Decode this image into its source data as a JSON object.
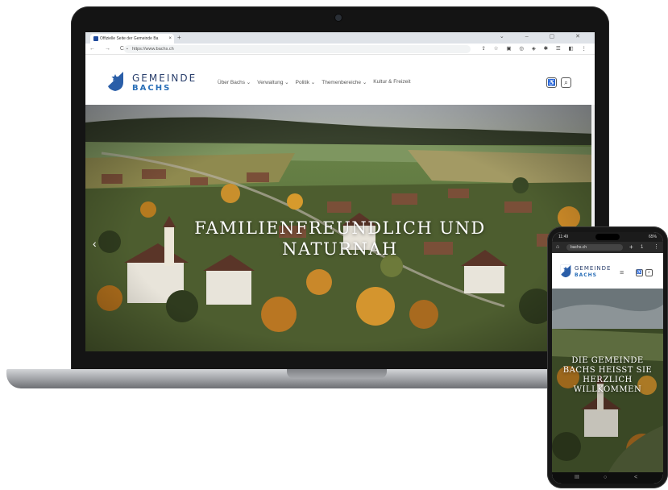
{
  "browser": {
    "tab_title": "Offizielle Seite der Gemeinde Ba",
    "tab_close": "×",
    "new_tab": "+",
    "window_controls": "⌄ – ▢ ✕",
    "nav_buttons": "← → C",
    "url": "https://www.bachs.ch",
    "extension_icons": "⇪ ☆ ▣ ◎ ◈ ✱ ☰ ◧ ⋮"
  },
  "site": {
    "brand_top": "GEMEINDE",
    "brand_bottom": "BACHS",
    "nav": [
      {
        "label": "Über Bachs ⌄"
      },
      {
        "label": "Verwaltung ⌄"
      },
      {
        "label": "Politik ⌄"
      },
      {
        "label": "Themenbereiche ⌄"
      },
      {
        "label": "Kultur & Freizeit"
      }
    ],
    "hero_title_line1": "FAMILIENFREUNDLICH UND",
    "hero_title_line2": "NATURNAH",
    "hero_arrow": "‹",
    "icons": {
      "accessibility": "accessibility-icon",
      "search": "search-icon"
    }
  },
  "phone": {
    "time": "11:49",
    "battery": "65%",
    "url": "bachs.ch",
    "plus": "+",
    "tab_count": "1",
    "menu": "⋮",
    "home": "⌂",
    "brand_top": "GEMEINDE",
    "brand_bottom": "BACHS",
    "burger": "≡",
    "hero_title_lines": [
      "DIE GEMEINDE",
      "BACHS HEISST SIE",
      "HERZLICH",
      "WILLKOMMEN"
    ],
    "nav_buttons": [
      "III",
      "○",
      "<"
    ]
  },
  "colors": {
    "brand_navy": "#2a3f6c",
    "brand_blue": "#2a6fb8"
  }
}
